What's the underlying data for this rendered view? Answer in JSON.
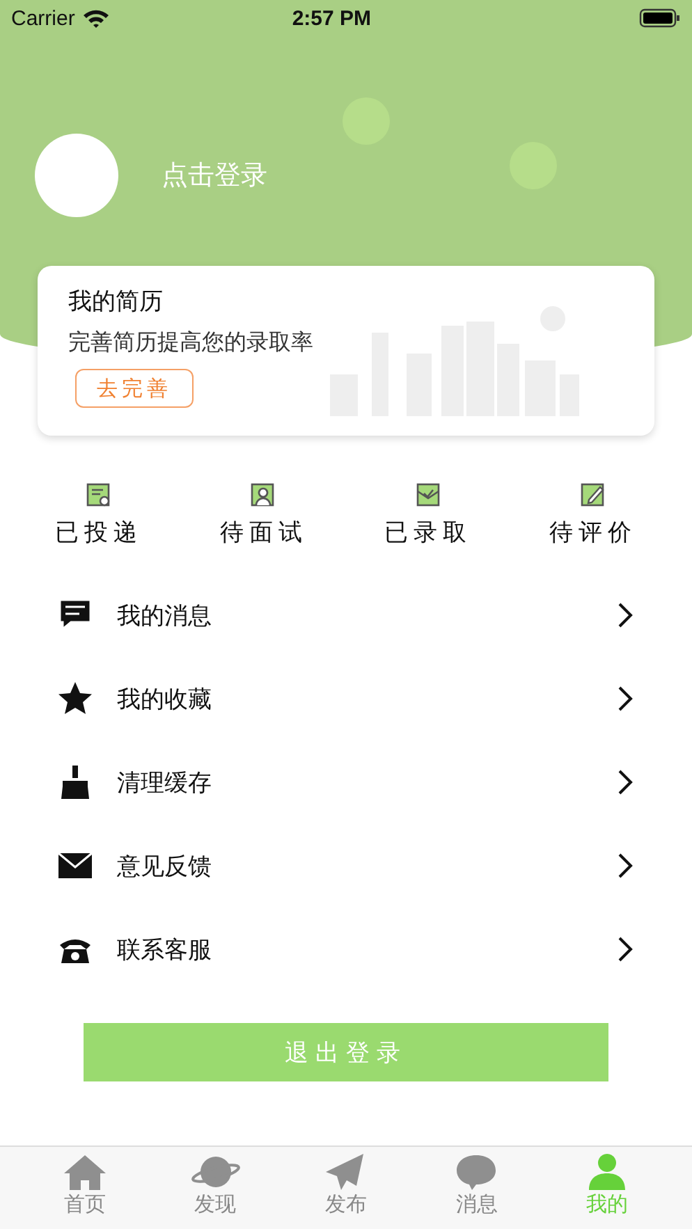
{
  "status_bar": {
    "carrier": "Carrier",
    "time": "2:57 PM"
  },
  "profile": {
    "login": "点击登录"
  },
  "resume_card": {
    "title": "我的简历",
    "subtitle": "完善简历提高您的录取率",
    "button": "去完善"
  },
  "stats": [
    {
      "label": "已投递"
    },
    {
      "label": "待面试"
    },
    {
      "label": "已录取"
    },
    {
      "label": "待评价"
    }
  ],
  "menu": [
    {
      "label": "我的消息"
    },
    {
      "label": "我的收藏"
    },
    {
      "label": "清理缓存"
    },
    {
      "label": "意见反馈"
    },
    {
      "label": "联系客服"
    }
  ],
  "logout": "退出登录",
  "tabs": [
    {
      "label": "首页",
      "selected": false
    },
    {
      "label": "发现",
      "selected": false
    },
    {
      "label": "发布",
      "selected": false
    },
    {
      "label": "消息",
      "selected": false
    },
    {
      "label": "我的",
      "selected": true
    }
  ]
}
